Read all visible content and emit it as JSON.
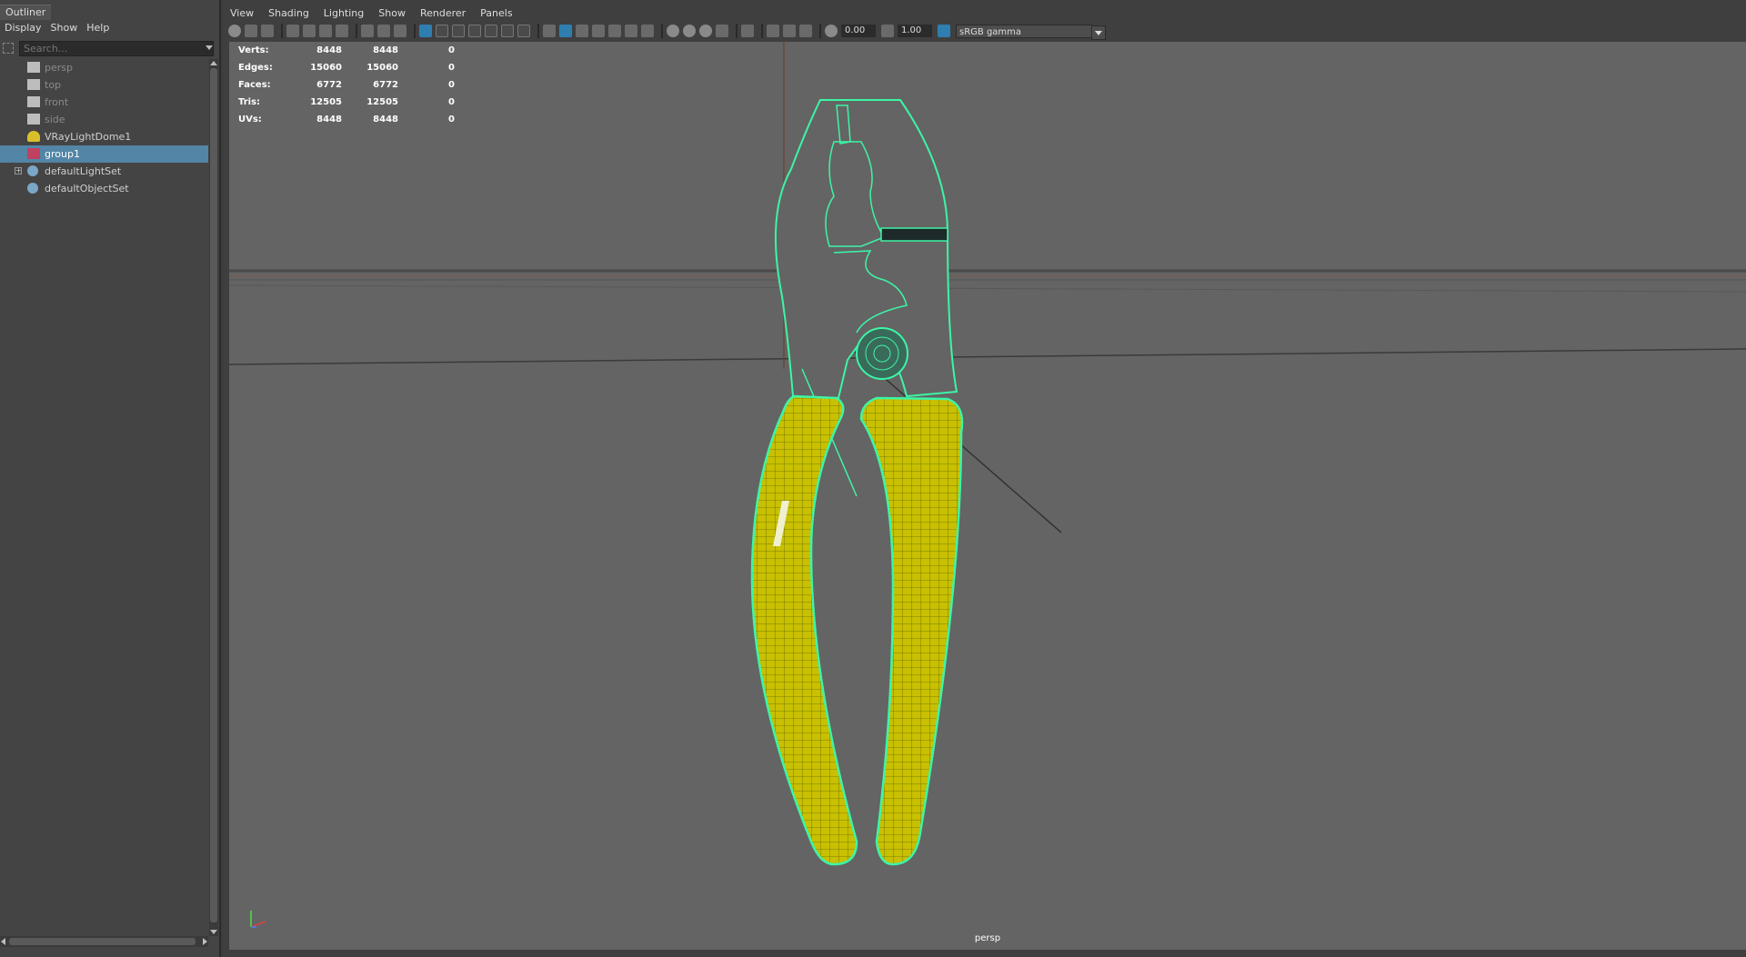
{
  "outliner": {
    "title": "Outliner",
    "menu": [
      "Display",
      "Show",
      "Help"
    ],
    "search_placeholder": "Search...",
    "items": [
      {
        "label": "persp",
        "icon": "camera-icon",
        "dim": true
      },
      {
        "label": "top",
        "icon": "camera-icon",
        "dim": true
      },
      {
        "label": "front",
        "icon": "camera-icon",
        "dim": true
      },
      {
        "label": "side",
        "icon": "camera-icon",
        "dim": true
      },
      {
        "label": "VRayLightDome1",
        "icon": "dome-light-icon",
        "dim": false
      },
      {
        "label": "group1",
        "icon": "group-icon",
        "dim": false,
        "selected": true
      },
      {
        "label": "defaultLightSet",
        "icon": "set-icon",
        "dim": false,
        "expandable": true
      },
      {
        "label": "defaultObjectSet",
        "icon": "set-icon",
        "dim": false
      }
    ]
  },
  "viewport_panel": {
    "menu": [
      "View",
      "Shading",
      "Lighting",
      "Show",
      "Renderer",
      "Panels"
    ],
    "exposure": "0.00",
    "gamma_value": "1.00",
    "color_space": "sRGB gamma",
    "camera": "persp"
  },
  "hud": {
    "rows": [
      {
        "label": "Verts:",
        "a": "8448",
        "b": "8448",
        "c": "0"
      },
      {
        "label": "Edges:",
        "a": "15060",
        "b": "15060",
        "c": "0"
      },
      {
        "label": "Faces:",
        "a": "6772",
        "b": "6772",
        "c": "0"
      },
      {
        "label": "Tris:",
        "a": "12505",
        "b": "12505",
        "c": "0"
      },
      {
        "label": "UVs:",
        "a": "8448",
        "b": "8448",
        "c": "0"
      }
    ]
  },
  "colors": {
    "selection": "#5285a6",
    "wire_highlight": "#3cf5a6",
    "handle": "#c8c000",
    "viewport_bg": "#646464"
  }
}
